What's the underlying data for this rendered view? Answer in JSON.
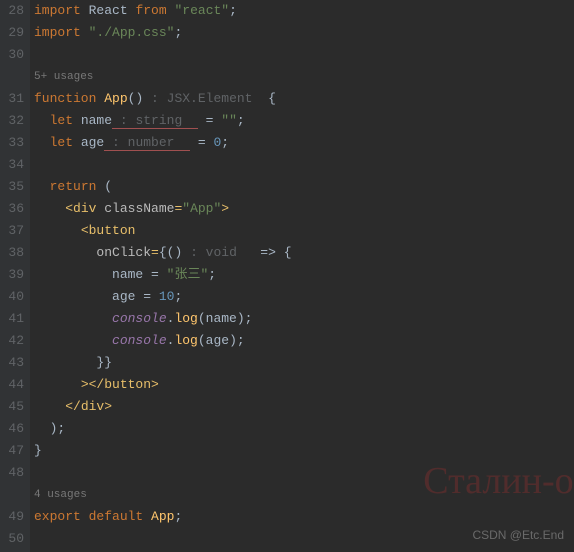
{
  "gutter": {
    "lines": [
      "28",
      "29",
      "30",
      "",
      "31",
      "32",
      "33",
      "34",
      "35",
      "36",
      "37",
      "38",
      "39",
      "40",
      "41",
      "42",
      "43",
      "44",
      "45",
      "46",
      "47",
      "48",
      "",
      "49",
      "50"
    ]
  },
  "usages": {
    "top": "5+ usages",
    "bottom": "4 usages"
  },
  "code": {
    "l28": {
      "kw1": "import",
      "id": "React",
      "kw2": "from",
      "str": "\"react\"",
      "end": ";"
    },
    "l29": {
      "kw1": "import",
      "str": "\"./App.css\"",
      "end": ";"
    },
    "l31": {
      "kw": "function",
      "fn": "App",
      "paren": "()",
      "hint": " : JSX.Element  ",
      "brace": "{"
    },
    "l32": {
      "kw": "let",
      "var": "name",
      "hint": " : string  ",
      "eq": " = ",
      "str": "\"\"",
      "end": ";"
    },
    "l33": {
      "kw": "let",
      "var": "age",
      "hint": " : number  ",
      "eq": " = ",
      "num": "0",
      "end": ";"
    },
    "l35": {
      "kw": "return",
      "paren": " ("
    },
    "l36": {
      "open": "<",
      "tag": "div",
      "sp": " ",
      "attr": "className",
      "eq": "=",
      "str": "\"App\"",
      "close": ">"
    },
    "l37": {
      "open": "<",
      "tag": "button"
    },
    "l38": {
      "attr": "onClick",
      "eq1": "=",
      "brace": "{",
      "paren": "()",
      "hint": " : void  ",
      "arrow": " => {",
      "sp": ""
    },
    "l39": {
      "var": "name",
      "eq": " = ",
      "str": "\"张三\"",
      "end": ";"
    },
    "l40": {
      "var": "age",
      "eq": " = ",
      "num": "10",
      "end": ";"
    },
    "l41": {
      "obj": "console",
      "dot": ".",
      "fn": "log",
      "open": "(",
      "arg": "name",
      "close": ");"
    },
    "l42": {
      "obj": "console",
      "dot": ".",
      "fn": "log",
      "open": "(",
      "arg": "age",
      "close": ");"
    },
    "l43": {
      "braces": "}}"
    },
    "l44": {
      "close": "></",
      "tag": "button",
      "end": ">"
    },
    "l45": {
      "close": "</",
      "tag": "div",
      "end": ">"
    },
    "l46": {
      "paren": ");"
    },
    "l47": {
      "brace": "}"
    },
    "l49": {
      "kw1": "export",
      "kw2": "default",
      "id": "App",
      "end": ";"
    }
  },
  "watermark": "CSDN @Etc.End",
  "bgText": "Сталин-он"
}
